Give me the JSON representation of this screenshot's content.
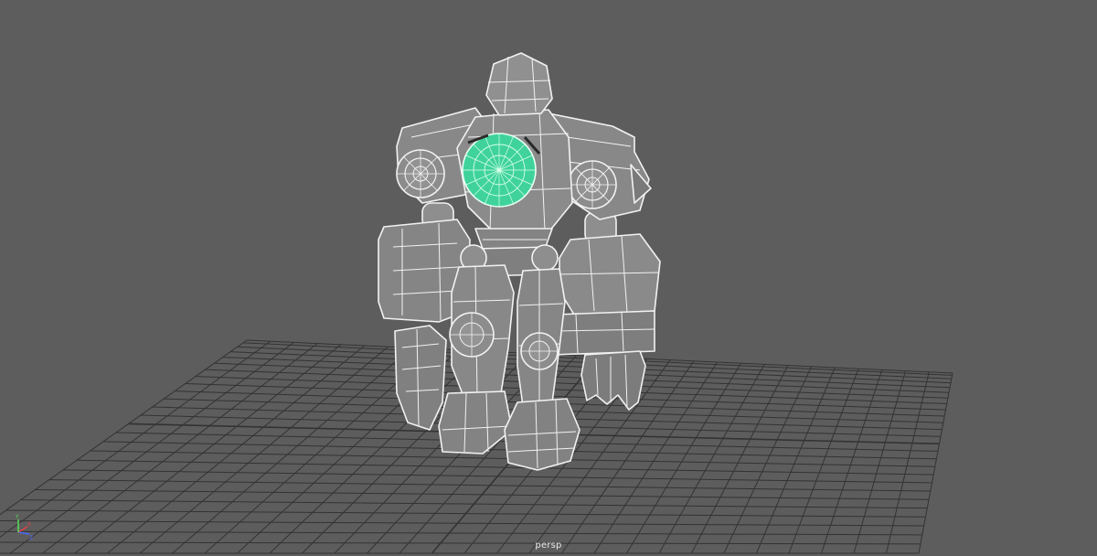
{
  "viewport": {
    "camera_name": "persp",
    "background_color": "#5d5d5d",
    "grid_color": "#333333",
    "wireframe_color": "#f2f2f2",
    "mesh_shade_color": "#8a8a8a",
    "selection_color": "#3fd39b"
  },
  "axis_gizmo": {
    "x_label": "X",
    "y_label": "Y",
    "z_label": "Z",
    "x_color": "#e04040",
    "y_color": "#58d858",
    "z_color": "#4a6cff"
  },
  "model": {
    "icon": "robot-mesh"
  }
}
